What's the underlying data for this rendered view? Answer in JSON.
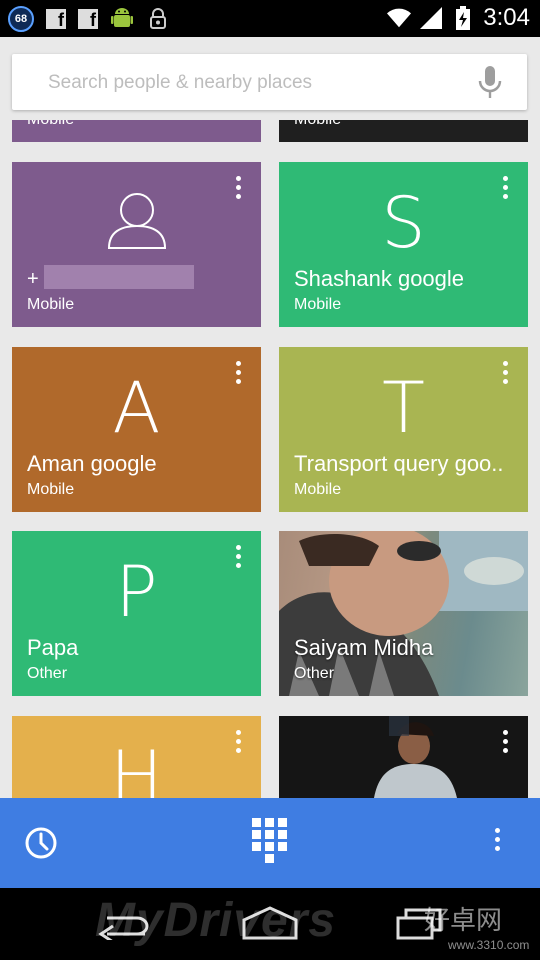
{
  "status_bar": {
    "notification_count": "68",
    "time": "3:04",
    "icons": [
      "notification-count-badge",
      "facebook-icon",
      "facebook-icon",
      "android-icon",
      "lock-icon",
      "wifi-icon",
      "signal-icon",
      "battery-charging-icon"
    ]
  },
  "search": {
    "placeholder": "Search people & nearby places",
    "value": ""
  },
  "partial_row": {
    "left_label": "Mobile",
    "right_label": "Mobile"
  },
  "contacts": [
    {
      "initial": "",
      "name": "+",
      "type": "Mobile",
      "color": "#7e5b8d",
      "avatar": "person-placeholder-icon"
    },
    {
      "initial": "S",
      "name": "Shashank google",
      "type": "Mobile",
      "color": "#2fba75"
    },
    {
      "initial": "A",
      "name": "Aman google",
      "type": "Mobile",
      "color": "#b0692b"
    },
    {
      "initial": "T",
      "name": "Transport query goo..",
      "type": "Mobile",
      "color": "#a9b552"
    },
    {
      "initial": "P",
      "name": "Papa",
      "type": "Other",
      "color": "#2fba75"
    },
    {
      "initial": "",
      "name": "Saiyam Midha",
      "type": "Other",
      "color": "#5f6a6d",
      "photo": true
    },
    {
      "initial": "H",
      "name": "",
      "type": "",
      "color": "#e4b04c"
    },
    {
      "initial": "",
      "name": "",
      "type": "",
      "color": "#2a2a2a",
      "photo": true
    }
  ],
  "bottom_bar": {
    "color": "#3f7de2",
    "icons": [
      "recent-clock-icon",
      "dialpad-icon",
      "overflow-menu-icon"
    ]
  },
  "nav_bar": {
    "icons": [
      "back-icon",
      "home-icon",
      "recent-apps-icon"
    ],
    "watermark": "MyDrivers",
    "watermark_site": "好卓网",
    "watermark_url": "www.3310.com"
  }
}
